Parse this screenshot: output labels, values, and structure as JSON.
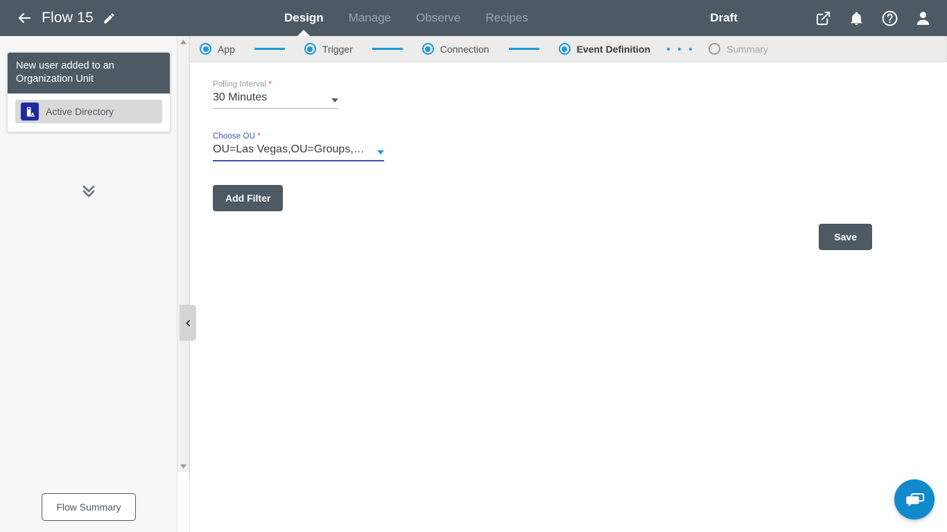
{
  "header": {
    "back_icon": "back-arrow-icon",
    "flow_title": "Flow 15",
    "edit_icon": "pencil-icon",
    "tabs": [
      {
        "label": "Design",
        "active": true
      },
      {
        "label": "Manage",
        "active": false
      },
      {
        "label": "Observe",
        "active": false
      },
      {
        "label": "Recipes",
        "active": false
      }
    ],
    "status": "Draft",
    "icons": [
      {
        "name": "external-link-icon"
      },
      {
        "name": "notification-bell-icon"
      },
      {
        "name": "help-circle-icon"
      },
      {
        "name": "user-avatar-icon"
      }
    ],
    "bg_color": "#4d5a64"
  },
  "sidebar": {
    "node_card": {
      "title": "New user added to an Organization Unit",
      "app_name": "Active Directory",
      "app_icon": "active-directory-icon",
      "app_icon_color": "#1f2a9e",
      "header_color": "#4d5a64"
    },
    "expand_icon": "double-chevron-down-icon",
    "flow_summary_label": "Flow Summary"
  },
  "scrollbar": {
    "up_icon": "scroll-up-arrow-icon",
    "down_icon": "scroll-down-arrow-icon"
  },
  "stepper": {
    "accent_color": "#1b9bd8",
    "steps": [
      {
        "label": "App",
        "state": "complete"
      },
      {
        "label": "Trigger",
        "state": "complete"
      },
      {
        "label": "Connection",
        "state": "complete"
      },
      {
        "label": "Event Definition",
        "state": "current"
      },
      {
        "label": "Summary",
        "state": "disabled"
      }
    ]
  },
  "form": {
    "polling_interval": {
      "label": "Polling Interval",
      "required_mark": "*",
      "value": "30 Minutes",
      "focused": false
    },
    "choose_ou": {
      "label": "Choose OU",
      "required_mark": "*",
      "value": "OU=Las Vegas,OU=Groups,DC=tele…",
      "focused": true,
      "focus_color": "#3f51b5"
    },
    "add_filter_label": "Add Filter",
    "save_label": "Save"
  },
  "collapse_handle": {
    "icon": "chevron-left-icon"
  },
  "chat": {
    "icon": "chat-bubble-icon",
    "color": "#118acb"
  }
}
